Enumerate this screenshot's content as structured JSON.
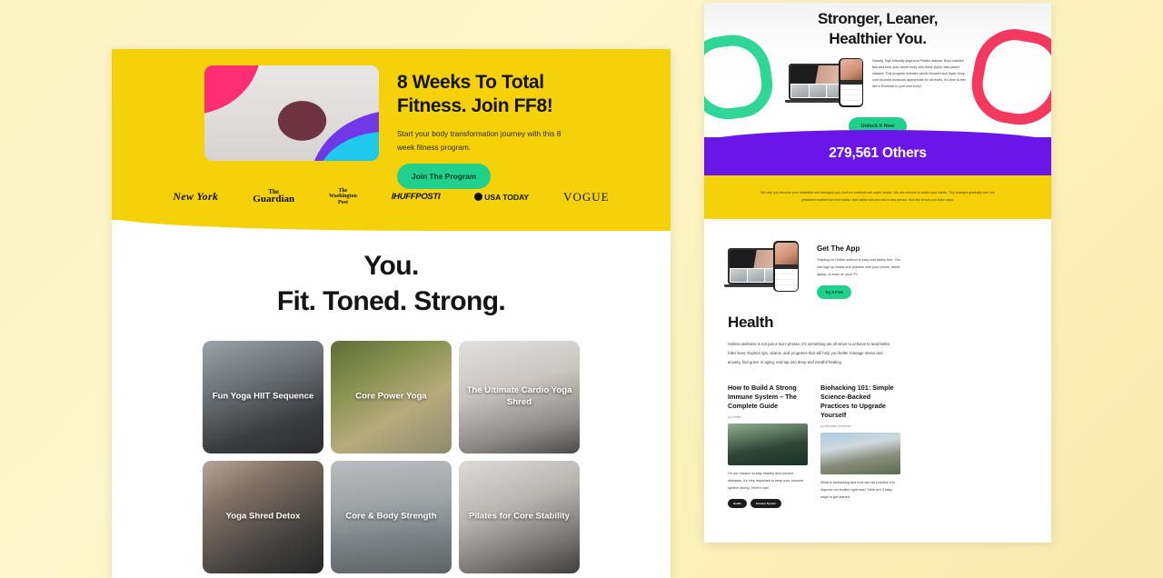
{
  "left_site": {
    "hero": {
      "title_line1": "8 Weeks To Total",
      "title_line2": "Fitness. Join FF8!",
      "subtitle": "Start your body transformation journey with this 8 week fitness program.",
      "cta_label": "Join The Program",
      "image_alt": "woman-stretching-against-white-wall"
    },
    "press": [
      {
        "name": "New York",
        "style": "newyork"
      },
      {
        "name": "The",
        "name2": "Guardian",
        "style": "guardian"
      },
      {
        "name": "The",
        "name2": "Washington",
        "name3": "Post",
        "style": "wapo"
      },
      {
        "name": "IHUFFPOSTI",
        "style": "huffpost"
      },
      {
        "name": "USA TODAY",
        "style": "usatoday"
      },
      {
        "name": "VOGUE",
        "style": "vogue"
      }
    ],
    "main_heading": {
      "line1": "You.",
      "line2": "Fit. Toned. Strong."
    },
    "cards": [
      {
        "label": "Fun Yoga HIIT Sequence",
        "theme": "c1"
      },
      {
        "label": "Core Power Yoga",
        "theme": "c2"
      },
      {
        "label": "The Ultimate Cardio Yoga Shred",
        "theme": "c3"
      },
      {
        "label": "Yoga Shred Detox",
        "theme": "c4"
      },
      {
        "label": "Core & Body Strength",
        "theme": "c5"
      },
      {
        "label": "Pilates for Core Stability",
        "theme": "c6"
      }
    ]
  },
  "right_site": {
    "hero": {
      "title_line1": "Stronger, Leaner,",
      "title_line2": "Healthier You.",
      "paragraph": "Sweaty, high intensity yoga and Pilates classes. Burn calories fast and tone your whole body with these joyful, fast-paced classes. This program includes cardio focused and lower body core focused workouts appropriate for all levels. It's time to feel like a Rockstar in your own body!",
      "cta_label": "Unlock It Now"
    },
    "purple_band": {
      "count": "279,561 Others"
    },
    "yellow_band": {
      "text": "We help you become your healthiest and strongest you. And our methods are super simple. We use science to rewire your habits. Tiny changes gradually turn into persistent routines turn into habits. And habits turn you into a new person. And this is how you learn ways."
    },
    "app_section": {
      "title": "Get The App",
      "description": "Training on Online method is easy and totally free. You can sign up below and practice with your phone, tablet, laptop, or even on your TV.",
      "cta_label": "Try It Free"
    },
    "health_section": {
      "title": "Health",
      "description": "Holistic wellness is not just a buzz phrase, it's something we all strive to achieve to lead better, fuller lives. Explore tips, videos, and programs that will help you better manage stress and anxiety, find grace in aging, and tap into deep and mindful healing."
    },
    "articles": [
      {
        "title": "How to Build A Strong Immune System – The Complete Guide",
        "byline": "by DeMar",
        "excerpt": "On our mission to stay healthy and prevent diseases, it's very important to keep your immune system strong. Here's how.",
        "tags": [
          "Health",
          "Immune System"
        ],
        "image_theme": "ai1"
      },
      {
        "title": "Biohacking 101: Simple Science-Backed Practices to Upgrade Yourself",
        "byline": "by Meredith Schneider",
        "excerpt": "What is biohacking and how can we practice it to improve our bodies right now? Here are 3 easy ways to get started.",
        "tags": [],
        "image_theme": "ai2"
      }
    ]
  },
  "colors": {
    "brand_yellow": "#f5d10a",
    "brand_green": "#1fd18a",
    "brand_purple": "#6b16e8",
    "brand_pink": "#f3395e",
    "ring_green": "#2fd695",
    "page_bg": "#fbf3c4"
  }
}
